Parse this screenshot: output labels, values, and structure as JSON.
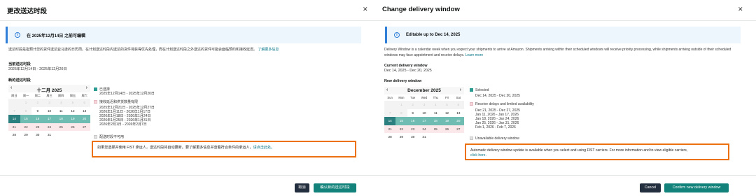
{
  "zh": {
    "title": "更改送达时段",
    "info": "在 2025年12月14日 之前可编辑",
    "desc": "送达时段是指预计您的货件送达亚马逊的日历周。在计划送达时段内送达的货件将获得优先处理，而在计划送达时段之外送达的货件可能会面临预约和接收延迟。",
    "learn_more": "了解更多信息",
    "current_label": "当前送达时段",
    "current_value": "2025年12月14日 - 2025年12月20日",
    "new_label": "新的送达时段",
    "month": "十二月 2025",
    "weekdays": [
      "周日",
      "周一",
      "周二",
      "周三",
      "周四",
      "周五",
      "周六"
    ],
    "legend_selected": "已选择",
    "selected_range": "2025年12月14日 - 2025年12月20日",
    "legend_limited": "接收延迟和供货数量有限",
    "limited_ranges": [
      "2025年12月21日 - 2025年12月27日",
      "2026年1月11日 - 2026年1月17日",
      "2026年1月18日 - 2026年1月24日",
      "2026年1月25日 - 2026年1月31日",
      "2026年2月1日 - 2026年2月7日"
    ],
    "legend_unavailable": "配送时段不可用",
    "notice": "如果您选择并使用 FIST 承运人，送达时段将自动更新。要了解更多信息并查看符合条件的承运人，",
    "notice_link": "请点击此处。",
    "cancel": "取消",
    "confirm": "确认新的送达时段"
  },
  "en": {
    "title": "Change delivery window",
    "info": "Editable up to Dec 14, 2025",
    "desc": "Delivery Window is a calendar week when you expect your shipments to arrive at Amazon. Shipments arriving within their scheduled windows will receive priority processing, while shipments arriving outside of their scheduled windows may face appointment and receive delays.",
    "learn_more": "Learn more",
    "current_label": "Current delivery window",
    "current_value": "Dec 14, 2025 - Dec 20, 2025",
    "new_label": "New delivery window",
    "month": "December 2025",
    "weekdays": [
      "Sun",
      "Mon",
      "Tue",
      "Wed",
      "Thu",
      "Fri",
      "Sat"
    ],
    "legend_selected": "Selected",
    "selected_range": "Dec 14, 2025 - Dec 20, 2025",
    "legend_limited": "Receive delays and limited availability",
    "limited_ranges": [
      "Dec 21, 2025 - Dec 27, 2025",
      "Jan 11, 2026 - Jan 17, 2026",
      "Jan 18, 2026 - Jan 24, 2026",
      "Jan 25, 2026 - Jan 31, 2026",
      "Feb 1, 2026 - Feb 7, 2026"
    ],
    "legend_unavailable": "Unavailable delivery window",
    "notice": "Automatic delivery window update is available when you select and using FIST carriers. For more information and to view eligible carriers,",
    "notice_link": "click here.",
    "cancel": "Cancel",
    "confirm": "Confirm new delivery window"
  },
  "close_icon": "close-icon",
  "info_icon": "info-icon",
  "calendar": {
    "weeks": [
      [
        {
          "d": "",
          "s": "dis"
        },
        {
          "d": "1",
          "s": "dis"
        },
        {
          "d": "2",
          "s": "dis"
        },
        {
          "d": "3",
          "s": "dis"
        },
        {
          "d": "4",
          "s": "dis"
        },
        {
          "d": "5",
          "s": "dis"
        },
        {
          "d": "6",
          "s": "dis"
        }
      ],
      [
        {
          "d": "7",
          "s": "dis"
        },
        {
          "d": "8",
          "s": "dis"
        },
        {
          "d": "9",
          "s": ""
        },
        {
          "d": "10",
          "s": ""
        },
        {
          "d": "11",
          "s": ""
        },
        {
          "d": "12",
          "s": ""
        },
        {
          "d": "13",
          "s": ""
        }
      ],
      [
        {
          "d": "14",
          "s": "sel-start"
        },
        {
          "d": "15",
          "s": "sel"
        },
        {
          "d": "16",
          "s": "sel"
        },
        {
          "d": "17",
          "s": "sel"
        },
        {
          "d": "18",
          "s": "sel"
        },
        {
          "d": "19",
          "s": "sel"
        },
        {
          "d": "20",
          "s": "sel"
        }
      ],
      [
        {
          "d": "21",
          "s": "ltd"
        },
        {
          "d": "22",
          "s": "ltd"
        },
        {
          "d": "23",
          "s": "ltd"
        },
        {
          "d": "24",
          "s": "ltd"
        },
        {
          "d": "25",
          "s": "ltd"
        },
        {
          "d": "26",
          "s": "ltd"
        },
        {
          "d": "27",
          "s": "ltd"
        }
      ],
      [
        {
          "d": "28",
          "s": ""
        },
        {
          "d": "29",
          "s": ""
        },
        {
          "d": "30",
          "s": ""
        },
        {
          "d": "31",
          "s": ""
        },
        {
          "d": "",
          "s": ""
        },
        {
          "d": "",
          "s": ""
        },
        {
          "d": "",
          "s": ""
        }
      ]
    ]
  },
  "colors": {
    "accent_info": "#2f7ed8",
    "selected": "#6fbcb2",
    "selected_start": "#2c7f7f",
    "limited": "#fbe8ea",
    "notice_border": "#ec7211",
    "confirm": "#12827a",
    "cancel": "#232f3e",
    "link": "#007185"
  }
}
